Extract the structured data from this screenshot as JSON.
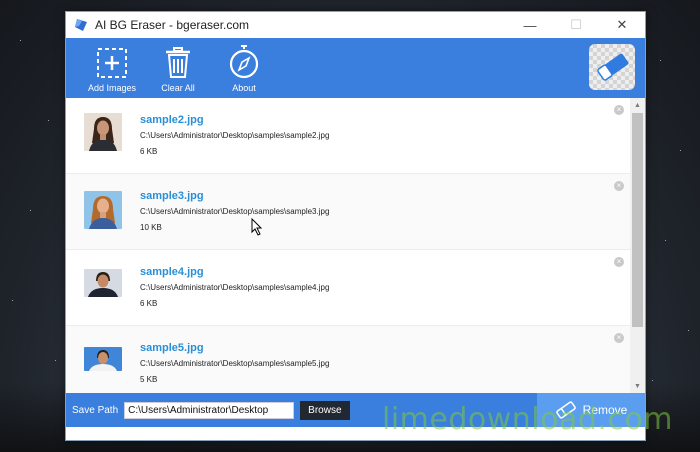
{
  "window": {
    "title": "AI BG Eraser - bgeraser.com",
    "controls": {
      "minimize": "—",
      "maximize": "☐",
      "close": "✕"
    }
  },
  "toolbar": {
    "add_images_label": "Add Images",
    "clear_all_label": "Clear All",
    "about_label": "About",
    "accent_color": "#3a7ede"
  },
  "files": [
    {
      "name": "sample2.jpg",
      "path": "C:\\Users\\Administrator\\Desktop\\samples\\sample2.jpg",
      "size": "6 KB"
    },
    {
      "name": "sample3.jpg",
      "path": "C:\\Users\\Administrator\\Desktop\\samples\\sample3.jpg",
      "size": "10 KB"
    },
    {
      "name": "sample4.jpg",
      "path": "C:\\Users\\Administrator\\Desktop\\samples\\sample4.jpg",
      "size": "6 KB"
    },
    {
      "name": "sample5.jpg",
      "path": "C:\\Users\\Administrator\\Desktop\\samples\\sample5.jpg",
      "size": "5 KB"
    }
  ],
  "footer": {
    "save_path_label": "Save Path",
    "save_path_value": "C:\\Users\\Administrator\\Desktop",
    "browse_label": "Browse",
    "remove_label": "Remove"
  },
  "watermark": {
    "text": "limedownload.com"
  }
}
